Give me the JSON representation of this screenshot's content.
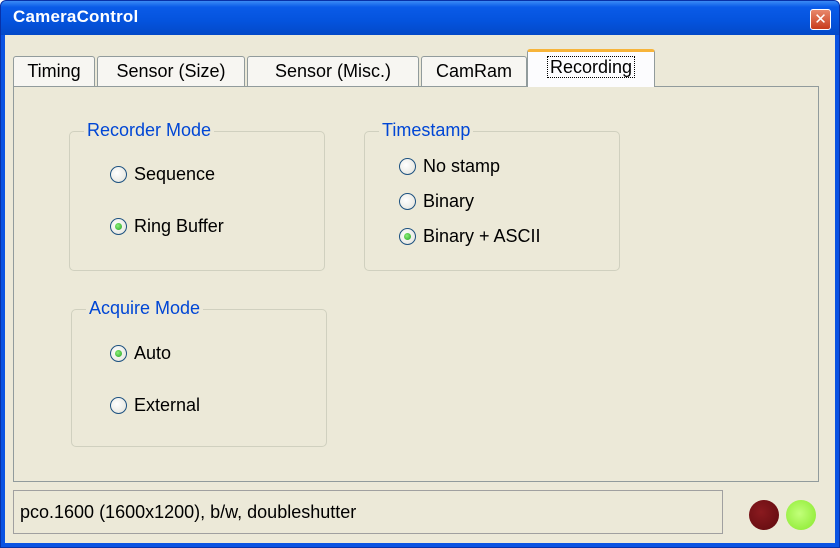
{
  "window": {
    "title": "CameraControl",
    "close_glyph": "✕"
  },
  "tabs": [
    {
      "label": "Timing"
    },
    {
      "label": "Sensor (Size)"
    },
    {
      "label": "Sensor (Misc.)"
    },
    {
      "label": "CamRam"
    },
    {
      "label": "Recording",
      "active": true
    }
  ],
  "recorder_mode": {
    "label": "Recorder Mode",
    "options": [
      {
        "label": "Sequence",
        "checked": false
      },
      {
        "label": "Ring Buffer",
        "checked": true
      }
    ]
  },
  "acquire_mode": {
    "label": "Acquire Mode",
    "options": [
      {
        "label": "Auto",
        "checked": true
      },
      {
        "label": "External",
        "checked": false
      }
    ]
  },
  "timestamp": {
    "label": "Timestamp",
    "options": [
      {
        "label": "No stamp",
        "checked": false
      },
      {
        "label": "Binary",
        "checked": false
      },
      {
        "label": "Binary + ASCII",
        "checked": true
      }
    ]
  },
  "status": {
    "text": "pco.1600 (1600x1200), b/w,  doubleshutter",
    "indicators": [
      {
        "name": "red-indicator",
        "color": "#6e1016"
      },
      {
        "name": "green-indicator",
        "color": "#a6f556"
      }
    ]
  }
}
